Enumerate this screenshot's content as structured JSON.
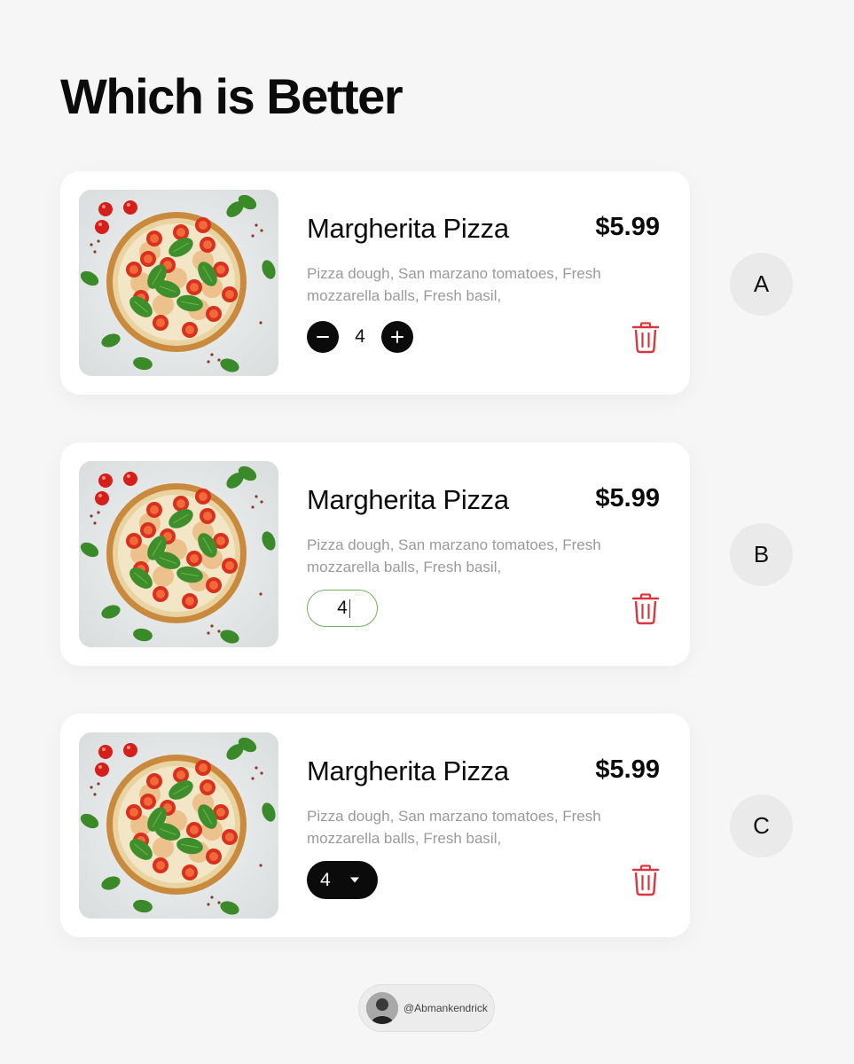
{
  "page": {
    "title": "Which is Better"
  },
  "item": {
    "name": "Margherita Pizza",
    "price": "$5.99",
    "description": "Pizza dough, San marzano tomatoes, Fresh mozzarella balls, Fresh basil,",
    "quantity": "4"
  },
  "options": [
    {
      "label": "A",
      "control": "stepper",
      "minus_icon": "minus-icon",
      "plus_icon": "plus-icon"
    },
    {
      "label": "B",
      "control": "text-input",
      "border_color": "#6db35e"
    },
    {
      "label": "C",
      "control": "dropdown",
      "chevron_icon": "chevron-down-icon"
    }
  ],
  "icons": {
    "delete": "trash-icon"
  },
  "colors": {
    "delete": "#d9363e",
    "button": "#0b0b0b",
    "input_border": "#6db35e",
    "description": "#9a9a9a"
  },
  "credit": {
    "handle": "@Abmankendrick"
  }
}
